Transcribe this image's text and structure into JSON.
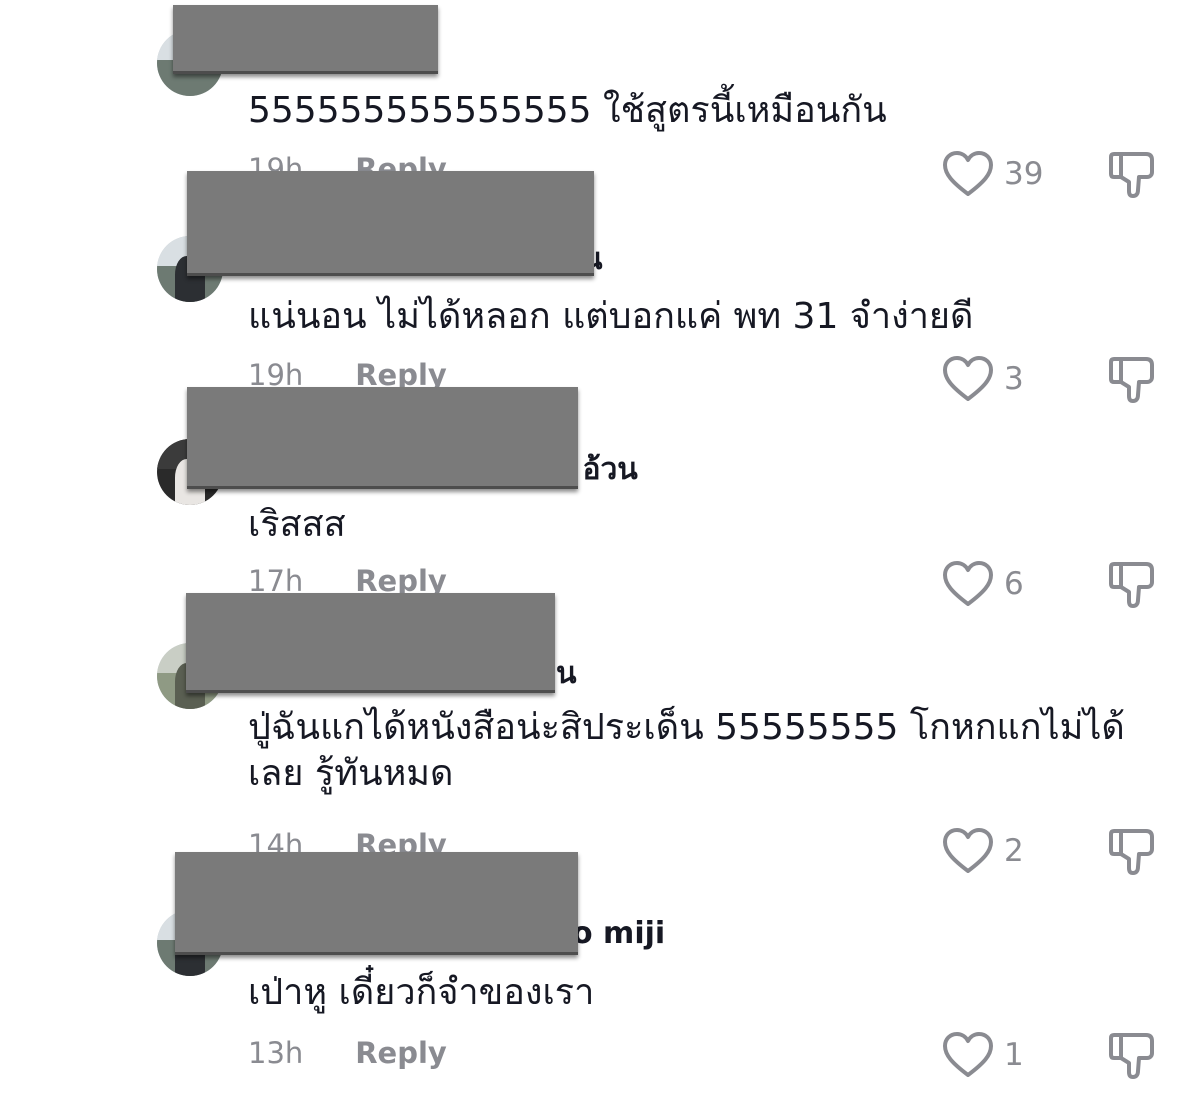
{
  "comments": [
    {
      "author_fragment": "",
      "text": "555555555555555 ใช้สูตรนี้เหมือนกัน",
      "time": "19h",
      "reply_label": "Reply",
      "likes": "39",
      "dislike_icon": "thumbs-down-icon",
      "like_icon": "heart-icon"
    },
    {
      "author_fragment": "น",
      "text": "แน่นอน ไม่ได้หลอก แต่บอกแค่ พท 31 จำง่ายดี",
      "time": "19h",
      "reply_label": "Reply",
      "likes": "3",
      "dislike_icon": "thumbs-down-icon",
      "like_icon": "heart-icon"
    },
    {
      "author_fragment": "ู อ้วน",
      "text": "เริสสส",
      "time": "17h",
      "reply_label": "Reply",
      "likes": "6",
      "dislike_icon": "thumbs-down-icon",
      "like_icon": "heart-icon"
    },
    {
      "author_fragment": "น",
      "text": "ปู่ฉันแกได้หนังสือน่ะสิประเด็น 55555555 โกหกแกไม่ได้เลย รู้ทันหมด",
      "time": "14h",
      "reply_label": "Reply",
      "likes": "2",
      "dislike_icon": "thumbs-down-icon",
      "like_icon": "heart-icon"
    },
    {
      "author_fragment": "o miji",
      "text": "เป่าหู เดี๋ยวก็จำของเรา",
      "time": "13h",
      "reply_label": "Reply",
      "likes": "1",
      "dislike_icon": "thumbs-down-icon",
      "like_icon": "heart-icon"
    }
  ],
  "colors": {
    "text": "#161823",
    "muted": "#8a8b91",
    "redaction": "#7a7a7a"
  }
}
